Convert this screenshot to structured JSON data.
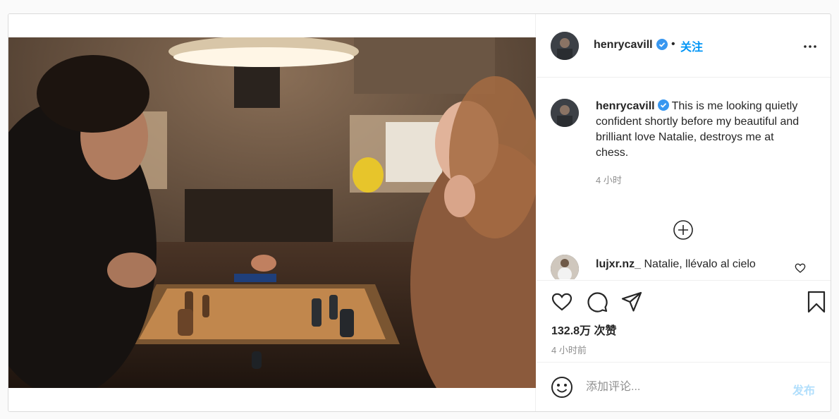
{
  "post": {
    "photo_alt": "",
    "author": {
      "username": "henrycavill",
      "verified": true
    },
    "header": {
      "separator": "•",
      "follow_label": "关注"
    },
    "caption": {
      "username": "henrycavill",
      "text": "This is me looking quietly confident shortly before my beautiful and brilliant love Natalie, destroys me at chess.",
      "time": "4 小时"
    },
    "comments": [
      {
        "username": "lujxr.nz_",
        "text": "Natalie, llévalo al cielo"
      }
    ],
    "likes": "132.8万 次赞",
    "time": "4 小时前",
    "add_comment": {
      "placeholder": "添加评论...",
      "publish_label": "发布"
    },
    "colors": {
      "link": "#0095f6",
      "verified": "#3897f0",
      "publish_disabled": "#b2dffc",
      "muted": "#8e8e8e"
    },
    "icons": [
      "more-options-icon",
      "verified-badge-icon",
      "load-more-plus-icon",
      "heart-icon",
      "comment-icon",
      "share-icon",
      "bookmark-icon",
      "emoji-icon"
    ]
  }
}
